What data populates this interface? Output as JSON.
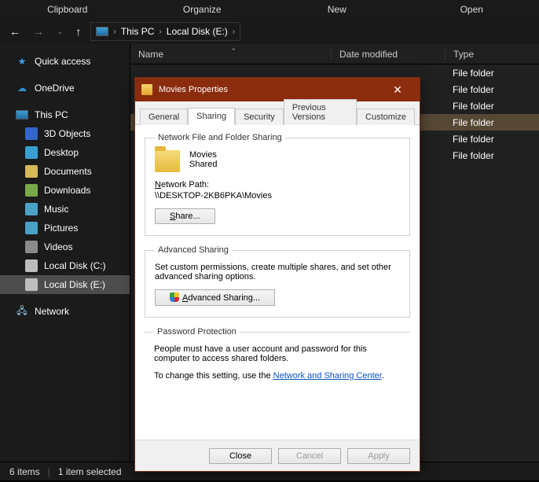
{
  "ribbon": [
    "Clipboard",
    "Organize",
    "New",
    "Open"
  ],
  "breadcrumb": {
    "pc": "This PC",
    "drive": "Local Disk (E:)"
  },
  "columns": {
    "name": "Name",
    "date": "Date modified",
    "type": "Type"
  },
  "sidebar": {
    "quick": "Quick access",
    "onedrive": "OneDrive",
    "thispc": "This PC",
    "items": [
      {
        "icon": "cube-icon",
        "label": "3D Objects",
        "color": "#36c"
      },
      {
        "icon": "desktop-icon",
        "label": "Desktop",
        "color": "#3b9fd6"
      },
      {
        "icon": "document-icon",
        "label": "Documents",
        "color": "#d7b85a"
      },
      {
        "icon": "download-icon",
        "label": "Downloads",
        "color": "#7aa94a"
      },
      {
        "icon": "music-icon",
        "label": "Music",
        "color": "#4aa1c7"
      },
      {
        "icon": "pictures-icon",
        "label": "Pictures",
        "color": "#4aa1c7"
      },
      {
        "icon": "videos-icon",
        "label": "Videos",
        "color": "#8a8a8a"
      },
      {
        "icon": "drive-icon",
        "label": "Local Disk (C:)",
        "color": "#bdbdbd"
      },
      {
        "icon": "drive-icon",
        "label": "Local Disk (E:)",
        "color": "#bdbdbd",
        "selected": true
      }
    ],
    "network": "Network"
  },
  "type_value": "File folder",
  "row_count": 6,
  "selected_row_index": 3,
  "status": {
    "items": "6 items",
    "selected": "1 item selected"
  },
  "dialog": {
    "title": "Movies Properties",
    "tabs": [
      "General",
      "Sharing",
      "Security",
      "Previous Versions",
      "Customize"
    ],
    "active_tab": "Sharing",
    "group_nfs": "Network File and Folder Sharing",
    "folder_name": "Movies",
    "folder_state": "Shared",
    "netpath_label_pre": "N",
    "netpath_label_post": "etwork Path:",
    "netpath_value": "\\\\DESKTOP-2KB6PKA\\Movies",
    "share_btn_pre": "S",
    "share_btn_post": "hare...",
    "group_adv": "Advanced Sharing",
    "adv_text": "Set custom permissions, create multiple shares, and set other advanced sharing options.",
    "adv_btn_pre": "A",
    "adv_btn_post": "dvanced Sharing...",
    "group_pw": "Password Protection",
    "pw_text": "People must have a user account and password for this computer to access shared folders.",
    "pw_change_pre": "To change this setting, use the ",
    "pw_link": "Network and Sharing Center",
    "pw_change_post": ".",
    "btn_close": "Close",
    "btn_cancel": "Cancel",
    "btn_apply": "Apply"
  }
}
